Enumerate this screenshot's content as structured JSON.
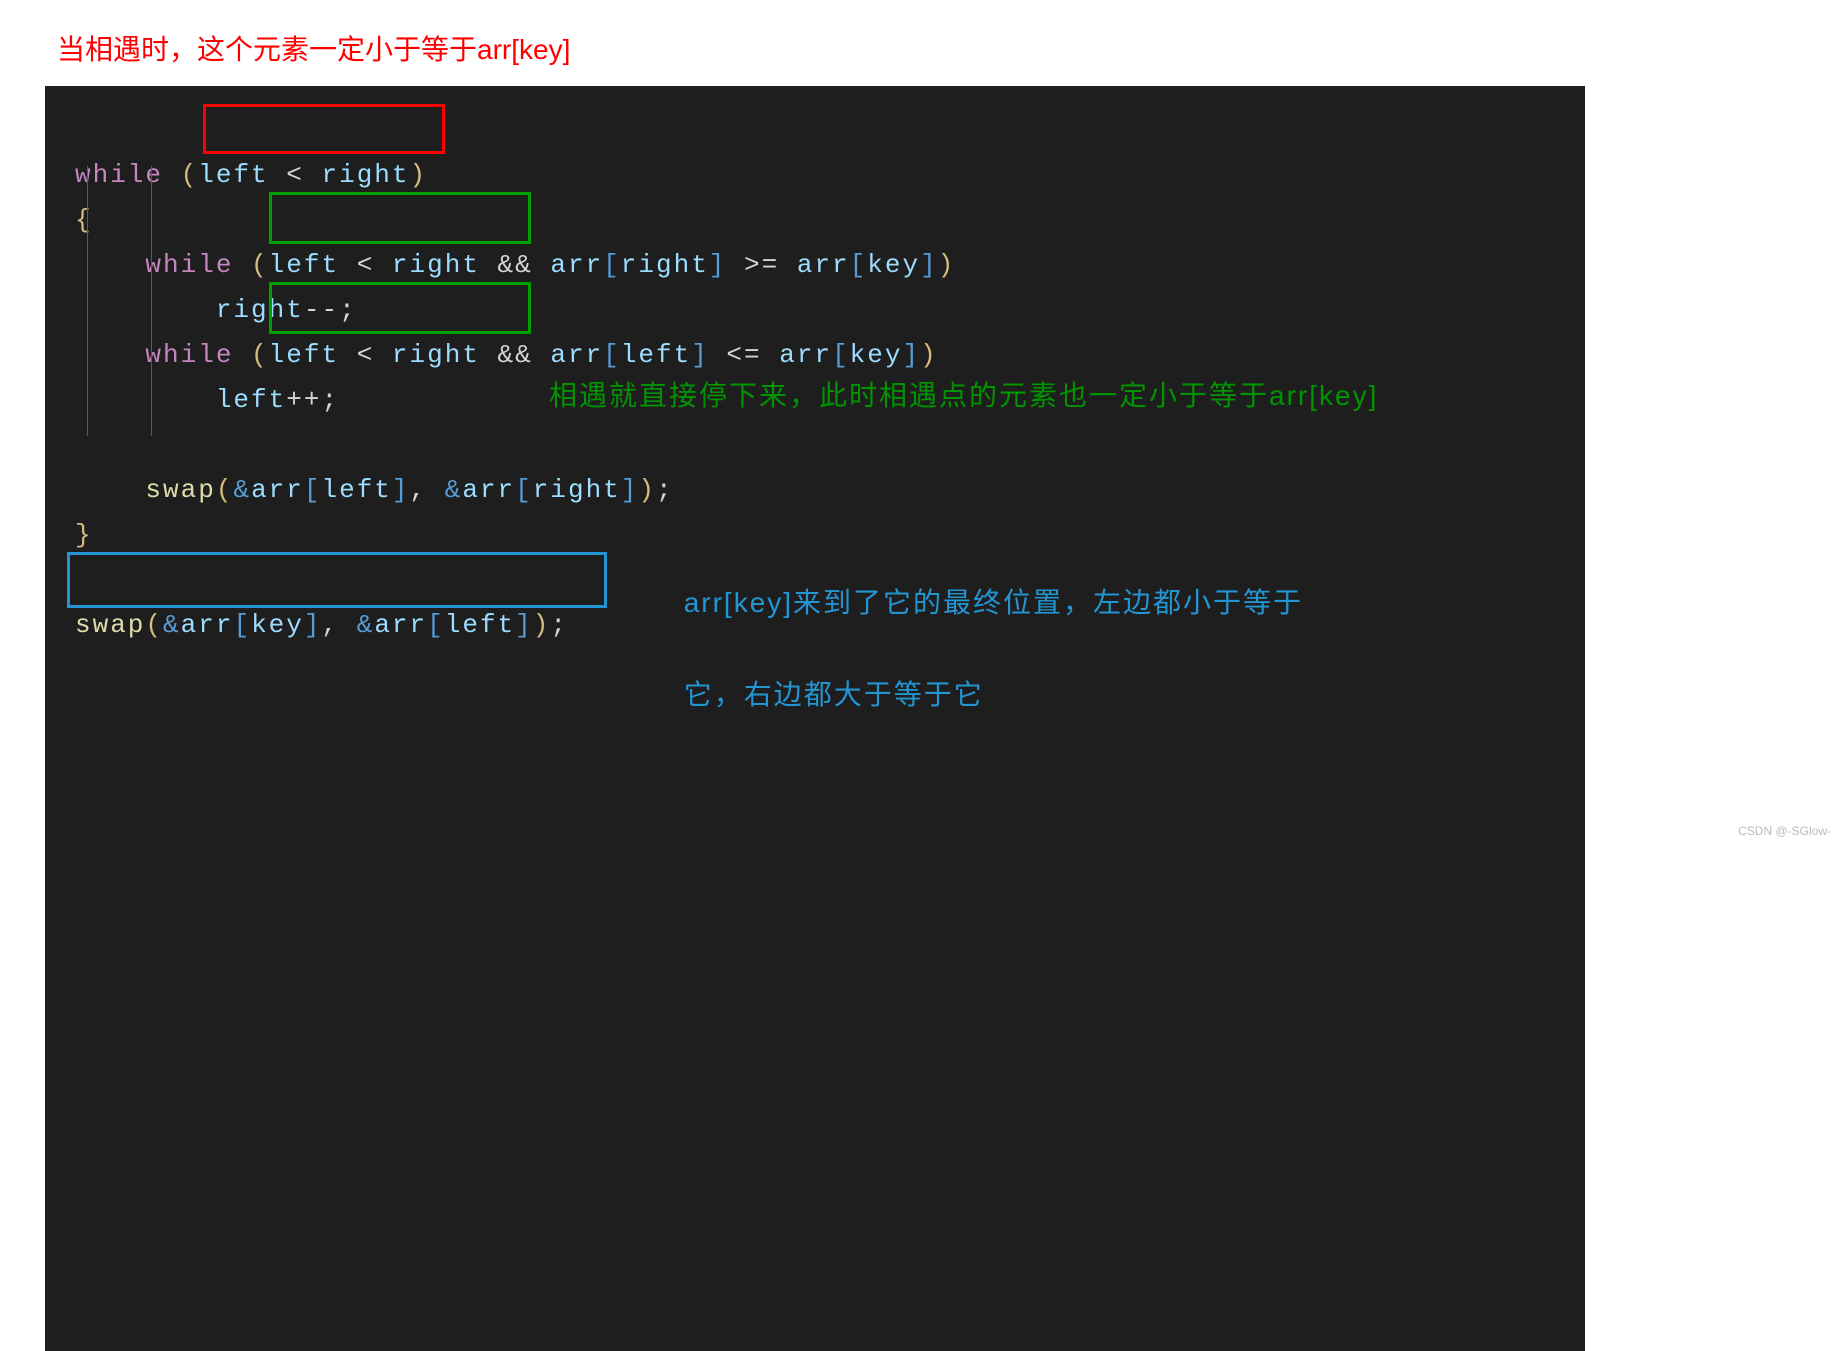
{
  "annotations": {
    "top_red": "当相遇时，这个元素一定小于等于arr[key]",
    "green": "相遇就直接停下来，此时相遇点的元素也一定小于等于arr[key]",
    "blue_line1": "arr[key]来到了它的最终位置，左边都小于等于",
    "blue_line2": "它，右边都大于等于它",
    "watermark": "CSDN @-SGlow-"
  },
  "code": {
    "while": "while",
    "swap": "swap",
    "left": "left",
    "right": "right",
    "arr": "arr",
    "key": "key",
    "lt": "<",
    "gte": ">=",
    "lte": "<=",
    "andand": "&&",
    "decrement": "--",
    "increment": "++",
    "amp": "&",
    "open_brace": "{",
    "close_brace": "}",
    "semicolon": ";",
    "comma": ",",
    "lparen": "(",
    "rparen": ")",
    "lbrack": "[",
    "rbrack": "]",
    "space": " "
  }
}
